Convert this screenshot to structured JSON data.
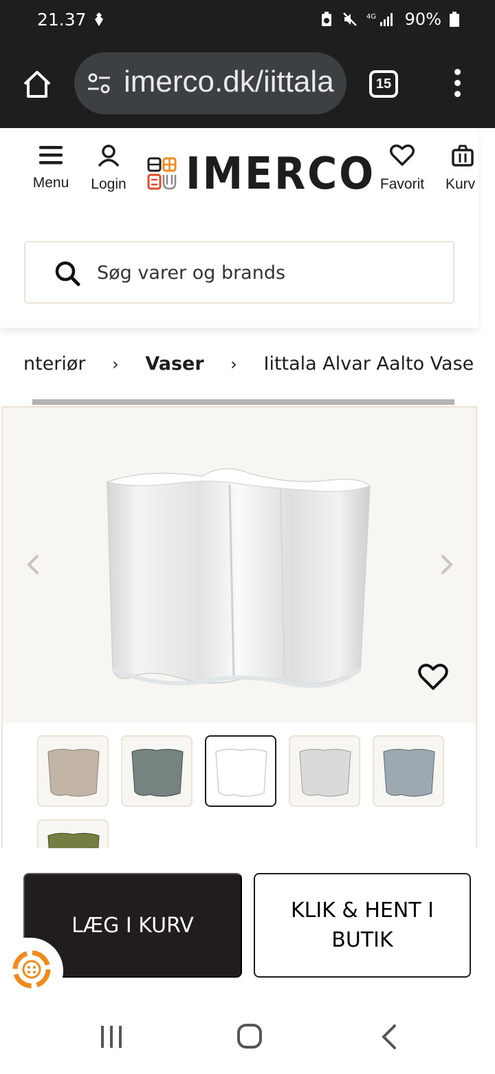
{
  "status_bar": {
    "time": "21.37",
    "battery": "90%"
  },
  "browser": {
    "url": "imerco.dk/iittala",
    "tab_count": "15"
  },
  "header": {
    "menu_label": "Menu",
    "login_label": "Login",
    "logo_text": "IMERCO",
    "favorites_label": "Favorit",
    "cart_label": "Kurv"
  },
  "search": {
    "placeholder": "Søg varer og brands"
  },
  "breadcrumb": {
    "items": [
      "nteriør",
      "Vaser",
      "Iittala Alvar Aalto Vase"
    ]
  },
  "product": {
    "thumbnails": [
      {
        "color": "#b9a996"
      },
      {
        "color": "#5f6e6b"
      },
      {
        "color": "#ffffff"
      },
      {
        "color": "#d4d6d6"
      },
      {
        "color": "#8e9aa3"
      },
      {
        "color": "#5e6a23"
      }
    ]
  },
  "actions": {
    "add_to_cart": "LÆG I KURV",
    "click_collect": "KLIK & HENT I BUTIK"
  },
  "colors": {
    "chrome": "#1e1e1e",
    "primary_button": "#211d1e",
    "accent": "#f08a1d",
    "border": "#ece2d6"
  }
}
